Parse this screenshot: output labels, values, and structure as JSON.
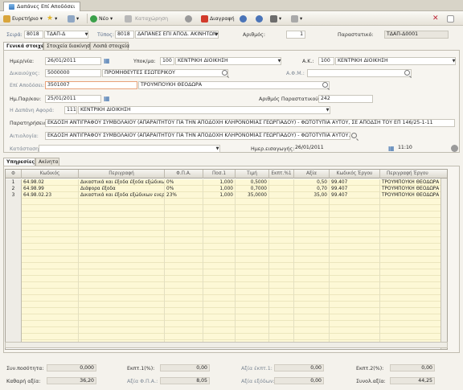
{
  "window": {
    "tab_title": "Δαπάνες Επί Αποδόσει"
  },
  "toolbar": {
    "search": "Ευρετήριο",
    "new": "Νέο",
    "template": "Καταχώρηση",
    "delete": "Διαγραφή"
  },
  "header": {
    "series_label": "Σειρά:",
    "series_code": "8018",
    "series_name": "ΤΔΑΠ-Δ",
    "type_label": "Τύπος:",
    "type_code": "8018",
    "type_name": "ΔΑΠΑΝΕΣ ΕΠΙ ΑΠΟΔ. ΑΚΙΝΗΤΩΝ",
    "number_label": "Αριθμός:",
    "number_value": "1",
    "doc_label": "Παραστατικό:",
    "doc_value": "ΤΔΑΠ-Δ0001"
  },
  "tabs": [
    "Γενικά στοιχεία",
    "Στοιχεία διακίνησης",
    "Λοιπά στοιχεία"
  ],
  "form": {
    "date_label": "Ημερ/νία:",
    "date_value": "26/01/2011",
    "branch_label": "Υποκ/μα:",
    "branch_code": "100",
    "branch_name": "ΚΕΝΤΡΙΚΗ ΔΙΟΙΚΗΣΗ",
    "ak_label": "Α.Κ.:",
    "ak_code": "100",
    "ak_name": "ΚΕΝΤΡΙΚΗ ΔΙΟΙΚΗΣΗ",
    "beneficiary_label": "Δικαιούχος:",
    "beneficiary_code": "5000000",
    "beneficiary_name": "ΠΡΟΜΗΘΕΥΤΕΣ ΕΣΩΤΕΡΙΚΟΥ",
    "afm_label": "Α.Φ.Μ.:",
    "advance_label": "Επί Αποδόσει:",
    "advance_code": "3501007",
    "advance_name": "ΤΡΟΥΜΠΟΥΚΗ ΘΕΟΔΩΡΑ",
    "docdate_label": "Ημ.Παρ/κου:",
    "docdate_value": "25/01/2011",
    "docno_label": "Αριθμός Παραστατικού:",
    "docno_value": "242",
    "concerns_label": "Η Δαπάνη Αφορά:",
    "concerns_code": "111",
    "concerns_name": "ΚΕΝΤΡΙΚΗ ΔΙΟΙΚΗΣΗ",
    "notes_label": "Παρατηρήσεις:",
    "notes_value": "ΕΚΔΟΣΗ ΑΝΤΙΓΡΑΦΟΥ ΣΥΜΒΟΛΑΙΟΥ (ΑΠΑΡΑΙΤΗΤΟΥ ΓΙΑ ΤΗΝ ΑΠΟΔΟΧΗ ΚΛΗΡΟΝΟΜΙΑΣ ΓΕΩΡΓΙΑΔΟΥ) - ΦΩΤΟΤΥΠΙΑ ΑΥΤΟΥ, ΣΕ ΑΠΟΔΣΗ ΤΟΥ ΕΠ 146/25-1-11",
    "justification_label": "Αιτιολογία:",
    "justification_value": "ΕΚΔΟΣΗ ΑΝΤΙΓΡΑΦΟΥ ΣΥΜΒΟΛΑΙΟΥ (ΑΠΑΡΑΙΤΗΤΟΥ ΓΙΑ ΤΗΝ ΑΠΟΔΟΧΗ ΚΛΗΡΟΝΟΜΙΑΣ ΓΕΩΡΓΙΑΔΟΥ) - ΦΩΤΟΤΥΠΙΑ ΑΥΤΟΥ..",
    "status_label": "Κατάσταση:",
    "entrydate_label": "Ημερ.εισαγωγής:",
    "entrydate_value": "26/01/2011",
    "entrytime_value": "11:10"
  },
  "subtabs": [
    "Υπηρεσίες",
    "Ακίνητα"
  ],
  "grid": {
    "columns": [
      "Κωδικός",
      "Περιγραφή",
      "Φ.Π.Α.",
      "Ποσ.1",
      "Τιμή",
      "Εκπτ.%1",
      "Αξία",
      "Κωδικός Έργου",
      "Περιγραφή Έργου"
    ],
    "rows": [
      {
        "n": "1",
        "code": "64.98.02",
        "desc": "Δικαστικά και έξοδα έξοδα εξώδικων",
        "vat": "0%",
        "qty": "1,000",
        "price": "0,5000",
        "disc": "",
        "value": "0,50",
        "proj": "99.407",
        "projdesc": "ΤΡΟΥΜΠΟΥΚΗ ΘΕΟΔΩΡΑ ΕΠ"
      },
      {
        "n": "2",
        "code": "64.98.99",
        "desc": "Διάφορα έξοδα",
        "vat": "0%",
        "qty": "1,000",
        "price": "0,7000",
        "disc": "",
        "value": "0,70",
        "proj": "99.407",
        "projdesc": "ΤΡΟΥΜΠΟΥΚΗ ΘΕΟΔΩΡΑ ΕΠ"
      },
      {
        "n": "3",
        "code": "64.98.02.23",
        "desc": "Δικαστικά και έξοδα εξώδικων ενεργ",
        "vat": "23%",
        "qty": "1,000",
        "price": "35,0000",
        "disc": "",
        "value": "35,00",
        "proj": "99.407",
        "projdesc": "ΤΡΟΥΜΠΟΥΚΗ ΘΕΟΔΩΡΑ ΕΠ"
      }
    ]
  },
  "totals": {
    "qty_label": "Συν.ποσότητα:",
    "qty_value": "0,000",
    "disc1_label": "Εκπτ.1(%):",
    "disc1_value": "0,00",
    "discval1_label": "Αξία έκπτ.1:",
    "discval1_value": "0,00",
    "disc2_label": "Εκπτ.2(%):",
    "disc2_value": "0,00",
    "net_label": "Καθαρή αξία:",
    "net_value": "36,20",
    "vat_label": "Αξία Φ.Π.Α.:",
    "vat_value": "8,05",
    "extra_label": "Αξία εξόδων:",
    "extra_value": "0,00",
    "total_label": "Συνολ.αξία:",
    "total_value": "44,25"
  }
}
